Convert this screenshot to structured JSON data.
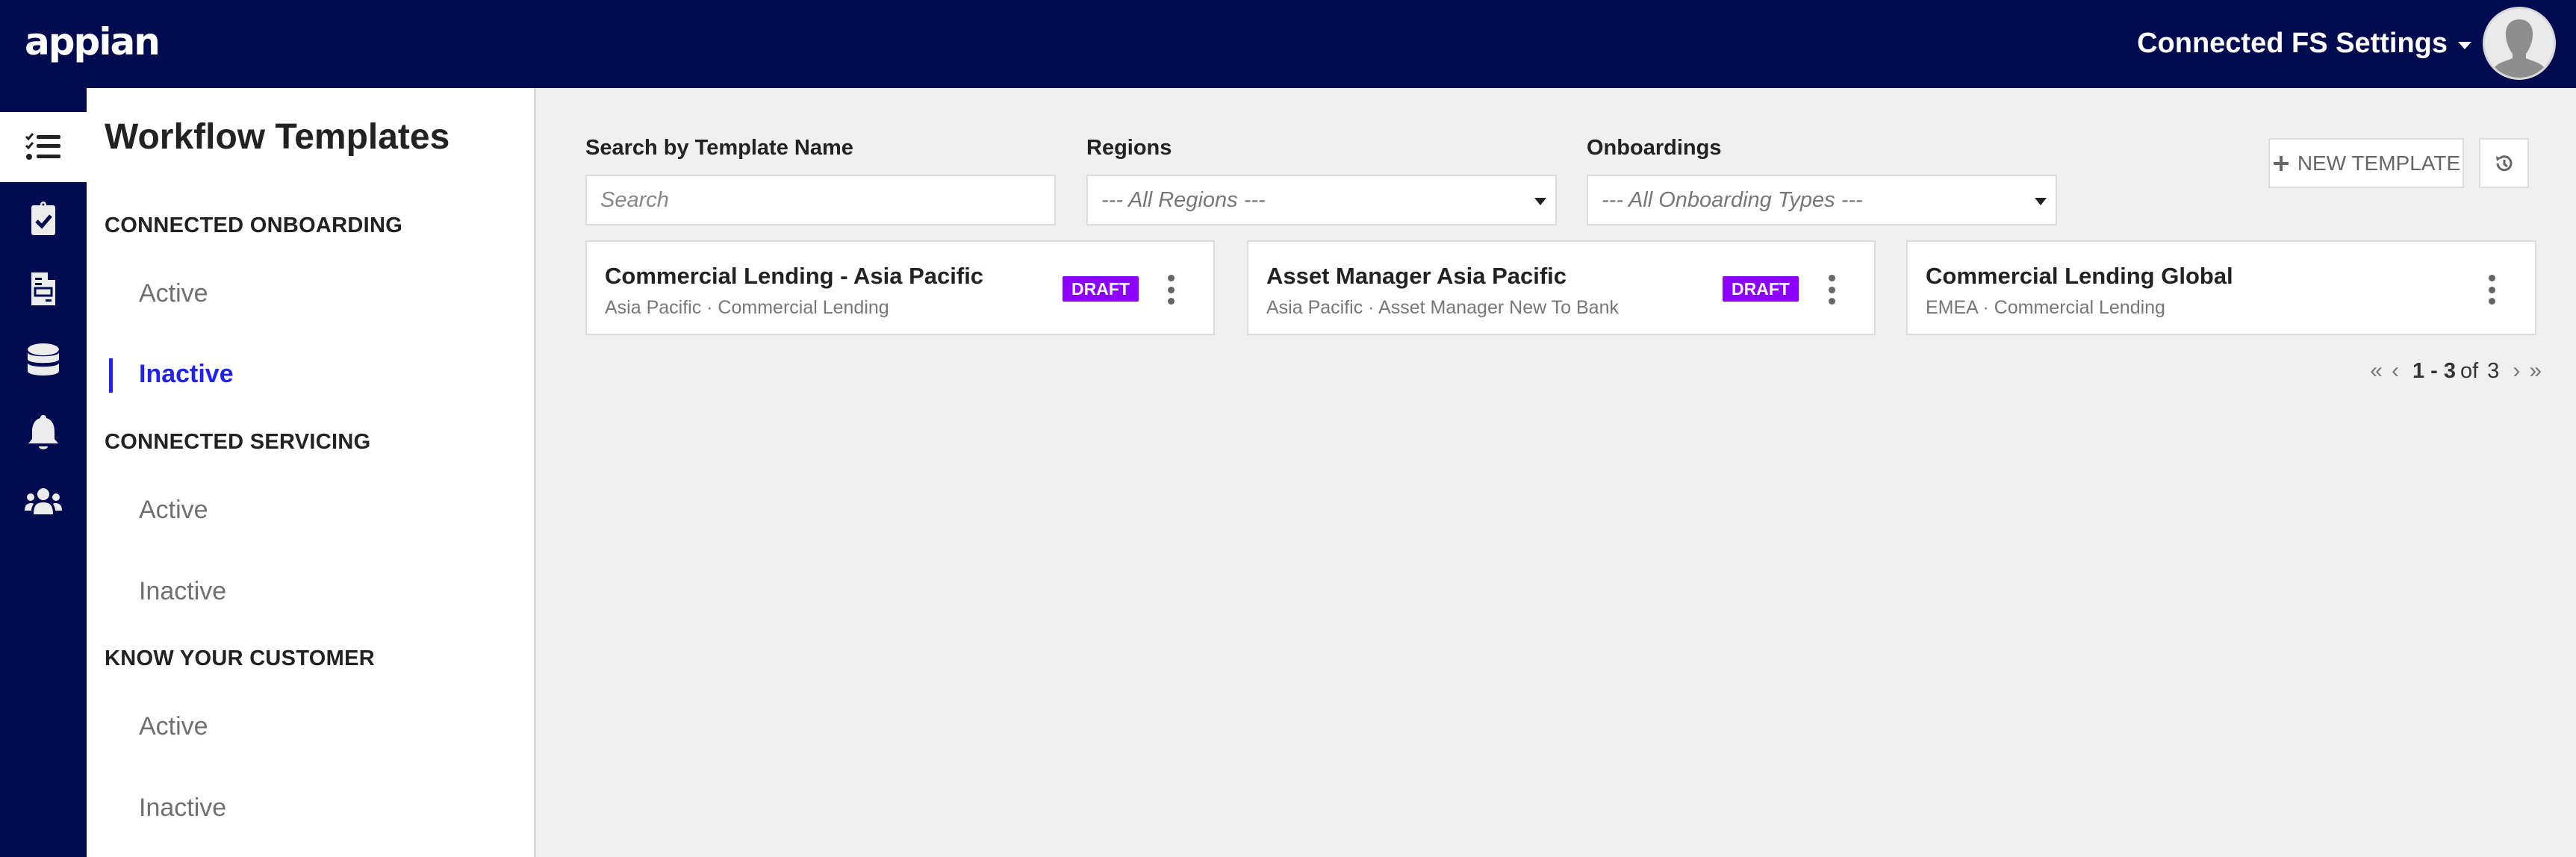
{
  "header": {
    "logo": "appian",
    "site_menu_label": "Connected FS Settings",
    "colors": {
      "header_bg": "#000b50",
      "accent": "#2222ee",
      "draft_badge": "#8b00ff"
    }
  },
  "rail": {
    "items": [
      {
        "icon": "checklist-icon",
        "active": true
      },
      {
        "icon": "clipboard-check-icon",
        "active": false
      },
      {
        "icon": "document-form-icon",
        "active": false
      },
      {
        "icon": "database-icon",
        "active": false
      },
      {
        "icon": "bell-icon",
        "active": false
      },
      {
        "icon": "users-group-icon",
        "active": false
      }
    ]
  },
  "nav": {
    "title": "Workflow Templates",
    "sections": [
      {
        "label": "CONNECTED ONBOARDING",
        "links": [
          "Active",
          "Inactive"
        ],
        "selected": "Inactive"
      },
      {
        "label": "CONNECTED SERVICING",
        "links": [
          "Active",
          "Inactive"
        ]
      },
      {
        "label": "KNOW YOUR CUSTOMER",
        "links": [
          "Active",
          "Inactive"
        ]
      }
    ]
  },
  "filters": {
    "search_label": "Search by Template Name",
    "search_placeholder": "Search",
    "search_value": "",
    "regions_label": "Regions",
    "regions_value": "--- All Regions ---",
    "onboardings_label": "Onboardings",
    "onboardings_value": "--- All Onboarding Types ---"
  },
  "toolbar": {
    "new_template_label": "NEW TEMPLATE",
    "history_icon": "history-icon"
  },
  "cards": [
    {
      "title": "Commercial Lending - Asia Pacific",
      "subtitle": "Asia Pacific · Commercial Lending",
      "badge": "DRAFT"
    },
    {
      "title": "Asset Manager Asia Pacific",
      "subtitle": "Asia Pacific · Asset Manager New To Bank",
      "badge": "DRAFT"
    },
    {
      "title": "Commercial Lending Global",
      "subtitle": "EMEA · Commercial Lending",
      "badge": null
    }
  ],
  "pagination": {
    "range": "1 - 3",
    "of_label": "of",
    "total": "3"
  }
}
